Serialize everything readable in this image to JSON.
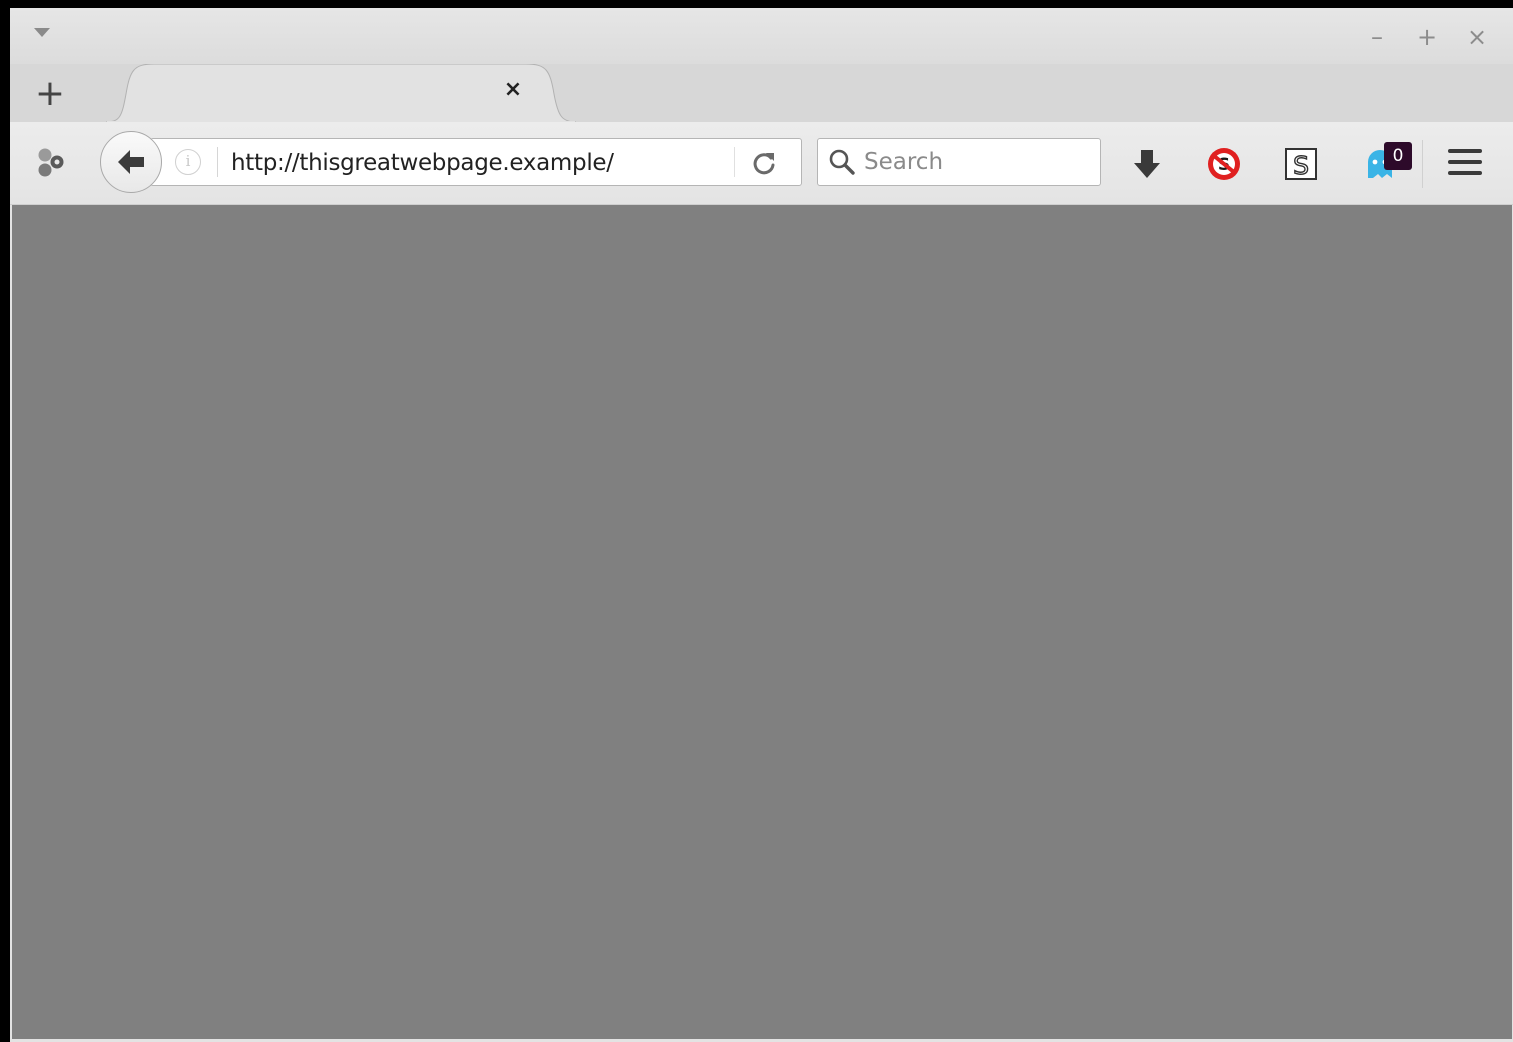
{
  "window": {
    "controls": {
      "minimize": "–",
      "maximize": "+",
      "close": "×"
    }
  },
  "tabs": {
    "new_tab_label": "+",
    "items": [
      {
        "title": "",
        "close_label": "×",
        "active": true
      }
    ]
  },
  "toolbar": {
    "url": "http://thisgreatwebpage.example/",
    "info_icon_glyph": "i",
    "search": {
      "placeholder": "Search",
      "value": ""
    },
    "icons": [
      "extension-logo-icon",
      "back-arrow-icon",
      "info-icon",
      "reload-icon",
      "search-icon",
      "download-icon",
      "blocker-icon",
      "s-extension-icon",
      "ghostery-icon",
      "hamburger-menu-icon"
    ],
    "ghost_badge_count": "0",
    "colors": {
      "blocker_red": "#e02020",
      "ghost_blue": "#3ab4e6",
      "badge_bg": "#2d0a2a"
    }
  },
  "content": {
    "background": "#808080"
  }
}
